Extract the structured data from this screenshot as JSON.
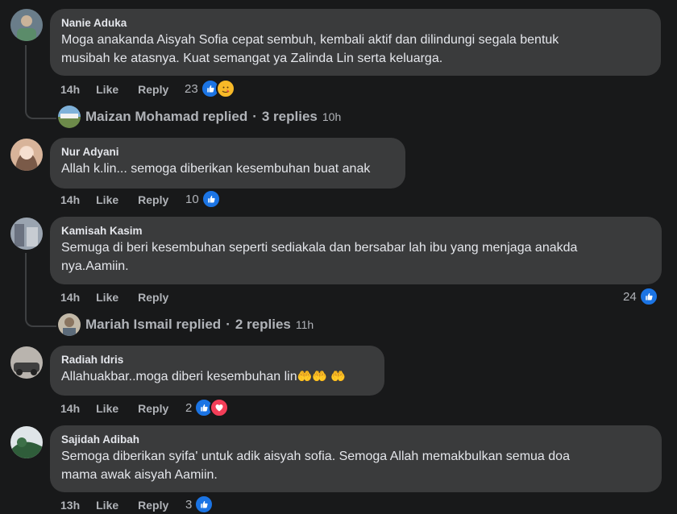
{
  "comments": [
    {
      "author": "Nanie Aduka",
      "text_line1": "Moga anakanda Aisyah Sofia cepat sembuh, kembali aktif dan dilindungi segala bentuk",
      "text_line2": "musibah ke atasnya. Kuat semangat ya Zalinda Lin serta keluarga.",
      "time": "14h",
      "like": "Like",
      "reply": "Reply",
      "reactions": {
        "count": "23",
        "icons": [
          "like-icon",
          "care-icon"
        ]
      },
      "replies": {
        "name": "Maizan Mohamad replied",
        "count": "3 replies",
        "time": "10h",
        "sep": "·"
      }
    },
    {
      "author": "Nur Adyani",
      "text_line1": "Allah k.lin... semoga diberikan kesembuhan buat anak",
      "time": "14h",
      "like": "Like",
      "reply": "Reply",
      "reactions": {
        "count": "10",
        "icons": [
          "like-icon"
        ]
      }
    },
    {
      "author": "Kamisah Kasim",
      "text_line1": "Semuga di beri kesembuhan seperti sediakala dan bersabar lah ibu yang menjaga anakda",
      "text_line2": "nya.Aamiin.",
      "time": "14h",
      "like": "Like",
      "reply": "Reply",
      "reactions": {
        "count": "24",
        "icons": [
          "like-icon"
        ]
      },
      "replies": {
        "name": "Mariah Ismail replied",
        "count": "2 replies",
        "time": "11h",
        "sep": "·"
      }
    },
    {
      "author": "Radiah Idris",
      "text_line1": "Allahuakbar..moga diberi kesembuhan lin",
      "emojis": "🤲🤲 🤲",
      "time": "14h",
      "like": "Like",
      "reply": "Reply",
      "reactions": {
        "count": "2",
        "icons": [
          "like-icon",
          "love-icon"
        ]
      }
    },
    {
      "author": "Sajidah Adibah",
      "text_line1": "Semoga diberikan syifa' untuk adik aisyah sofia. Semoga Allah memakbulkan semua doa",
      "text_line2": "mama awak aisyah Aamiin.",
      "time": "13h",
      "like": "Like",
      "reply": "Reply",
      "reactions": {
        "count": "3",
        "icons": [
          "like-icon"
        ]
      }
    }
  ],
  "colors": {
    "background": "#18191a",
    "bubble": "#3a3b3c",
    "like_blue": "#1b74e4",
    "love_red": "#f33e58",
    "care_yellow": "#f7b928"
  }
}
